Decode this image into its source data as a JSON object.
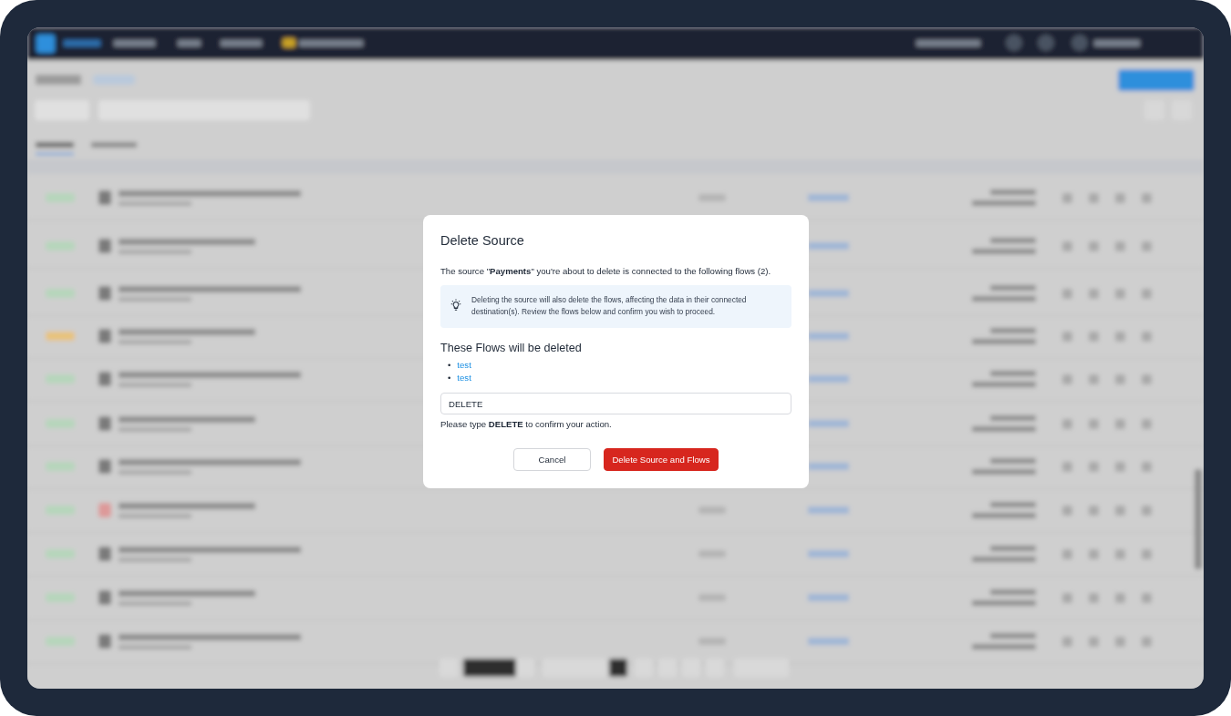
{
  "dialog": {
    "title": "Delete Source",
    "message": "The source \"**Payments**\" you're about to delete is connected to the following flows (2).",
    "notice": "Deleting the source will also delete the flows, affecting the data in their connected destination(s). Review the flows below and confirm you wish to proceed.",
    "flows_heading": "These Flows will be deleted",
    "flows": [
      {
        "bullet": "•",
        "label": "test"
      },
      {
        "bullet": "•",
        "label": "test"
      }
    ],
    "confirm_field": {
      "value": "DELETE"
    },
    "hint": "Please type **DELETE** to confirm your action.",
    "buttons": [
      {
        "label": "Cancel",
        "kind": "secondary"
      },
      {
        "label": "Delete Source and Flows",
        "kind": "danger"
      }
    ]
  }
}
